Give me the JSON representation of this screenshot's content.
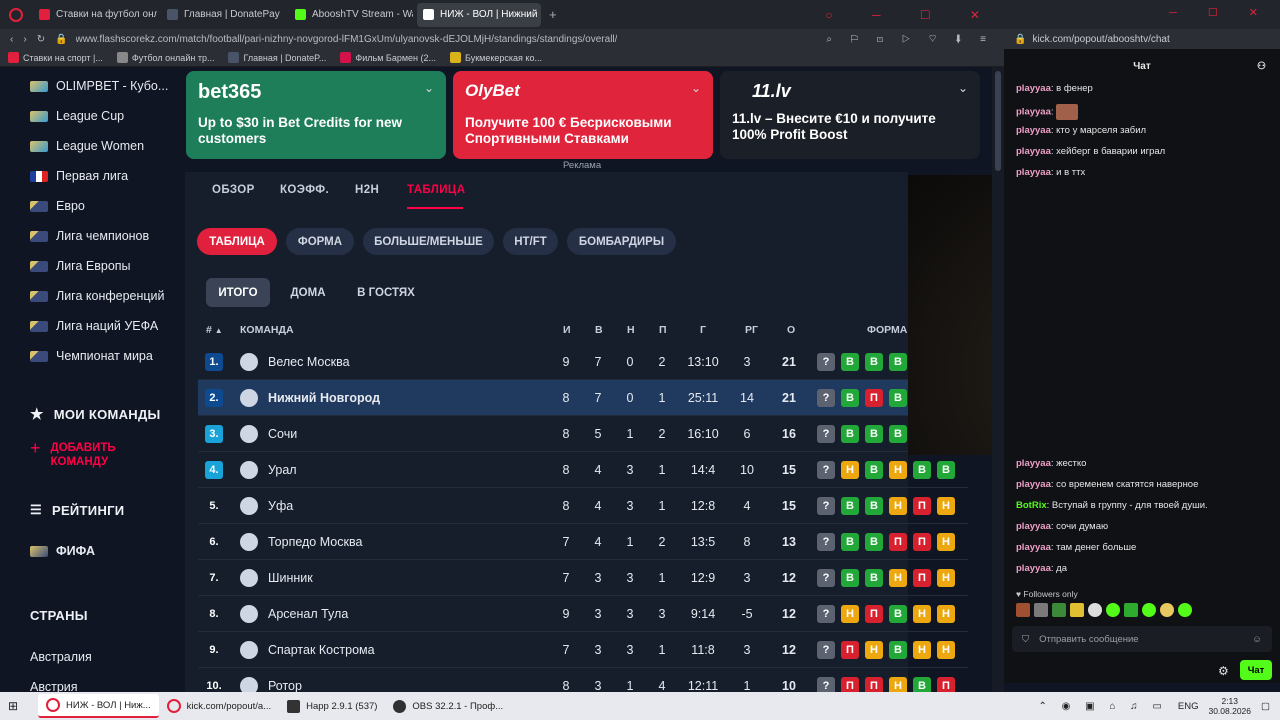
{
  "browser": {
    "tabs": [
      {
        "label": "Ставки на футбол онлайн",
        "color": "#e0203c"
      },
      {
        "label": "Главная | DonatePay",
        "color": "#2a3140"
      },
      {
        "label": "AbooshTV Stream - Watch",
        "color": "#53fc18"
      },
      {
        "label": "НИЖ - ВОЛ | Нижний Нов",
        "color": "#ffffff"
      }
    ],
    "url": "www.flashscorekz.com/match/football/pari-nizhny-novgorod-lFM1GxUm/ulyanovsk-dEJOLMjH/standings/standings/overall/",
    "bookmarks": [
      "Ставки на спорт |...",
      "Футбол онлайн тр...",
      "Главная | DonateP...",
      "Фильм Бармен (2...",
      "Букмекерская ко..."
    ]
  },
  "sidebar": {
    "leagues": [
      "OLIMPBET - Кубо...",
      "League Cup",
      "League Women",
      "Первая лига",
      "Евро",
      "Лига чемпионов",
      "Лига Европы",
      "Лига конференций",
      "Лига наций УЕФА",
      "Чемпионат мира"
    ],
    "my_teams": "МОИ КОМАНДЫ",
    "add_team": "ДОБАВИТЬ КОМАНДУ",
    "ratings": "РЕЙТИНГИ",
    "fifa": "ФИФА",
    "countries_title": "СТРАНЫ",
    "countries": [
      "Австралия",
      "Австрия"
    ]
  },
  "ads": [
    {
      "logo": "bet365",
      "text": "Up to $30 in Bet Credits for new customers",
      "color": "#1e7e5a"
    },
    {
      "logo": "OlyBet",
      "text": "Получите 100 € Бесрисковыми Спортивными Ставками",
      "color": "#e0243c"
    },
    {
      "logo": "11.lv",
      "text": "11.lv – Внесите €10 и получите 100% Profit Boost",
      "color": "#1b1f27"
    }
  ],
  "ad_label": "Реклама",
  "match_tabs": [
    "ОБЗОР",
    "КОЭФФ.",
    "H2H",
    "ТАБЛИЦА"
  ],
  "table_tabs": [
    "ТАБЛИЦА",
    "ФОРМА",
    "БОЛЬШЕ/МЕНЬШЕ",
    "HT/FT",
    "БОМБАРДИРЫ"
  ],
  "venue_tabs": [
    "ИТОГО",
    "ДОМА",
    "В ГОСТЯХ"
  ],
  "headers": {
    "rank": "#",
    "team": "КОМАНДА",
    "played": "И",
    "won": "В",
    "draw": "Н",
    "lost": "П",
    "goals": "Г",
    "gd": "РГ",
    "points": "О",
    "form": "ФОРМА"
  },
  "standings": [
    {
      "rank": "1.",
      "team": "Велес Москва",
      "p": "9",
      "w": "7",
      "d": "0",
      "l": "2",
      "g": "13:10",
      "gd": "3",
      "pts": "21",
      "form": [
        "?",
        "В",
        "В",
        "В"
      ]
    },
    {
      "rank": "2.",
      "team": "Нижний Новгород",
      "p": "8",
      "w": "7",
      "d": "0",
      "l": "1",
      "g": "25:11",
      "gd": "14",
      "pts": "21",
      "form": [
        "?",
        "В",
        "П",
        "В"
      ]
    },
    {
      "rank": "3.",
      "team": "Сочи",
      "p": "8",
      "w": "5",
      "d": "1",
      "l": "2",
      "g": "16:10",
      "gd": "6",
      "pts": "16",
      "form": [
        "?",
        "В",
        "В",
        "В"
      ]
    },
    {
      "rank": "4.",
      "team": "Урал",
      "p": "8",
      "w": "4",
      "d": "3",
      "l": "1",
      "g": "14:4",
      "gd": "10",
      "pts": "15",
      "form": [
        "?",
        "Н",
        "В",
        "Н",
        "В",
        "В"
      ]
    },
    {
      "rank": "5.",
      "team": "Уфа",
      "p": "8",
      "w": "4",
      "d": "3",
      "l": "1",
      "g": "12:8",
      "gd": "4",
      "pts": "15",
      "form": [
        "?",
        "В",
        "В",
        "Н",
        "П",
        "Н"
      ]
    },
    {
      "rank": "6.",
      "team": "Торпедо Москва",
      "p": "7",
      "w": "4",
      "d": "1",
      "l": "2",
      "g": "13:5",
      "gd": "8",
      "pts": "13",
      "form": [
        "?",
        "В",
        "В",
        "П",
        "П",
        "Н"
      ]
    },
    {
      "rank": "7.",
      "team": "Шинник",
      "p": "7",
      "w": "3",
      "d": "3",
      "l": "1",
      "g": "12:9",
      "gd": "3",
      "pts": "12",
      "form": [
        "?",
        "В",
        "В",
        "Н",
        "П",
        "Н"
      ]
    },
    {
      "rank": "8.",
      "team": "Арсенал Тула",
      "p": "9",
      "w": "3",
      "d": "3",
      "l": "3",
      "g": "9:14",
      "gd": "-5",
      "pts": "12",
      "form": [
        "?",
        "Н",
        "П",
        "В",
        "Н",
        "Н"
      ]
    },
    {
      "rank": "9.",
      "team": "Спартак Кострома",
      "p": "7",
      "w": "3",
      "d": "3",
      "l": "1",
      "g": "11:8",
      "gd": "3",
      "pts": "12",
      "form": [
        "?",
        "П",
        "Н",
        "В",
        "Н",
        "Н"
      ]
    },
    {
      "rank": "10.",
      "team": "Ротор",
      "p": "8",
      "w": "3",
      "d": "1",
      "l": "4",
      "g": "12:11",
      "gd": "1",
      "pts": "10",
      "form": [
        "?",
        "П",
        "П",
        "Н",
        "В",
        "П"
      ]
    }
  ],
  "chat": {
    "url": "kick.com/popout/abooshtv/chat",
    "title": "Чат",
    "messages_top": [
      {
        "user": "playyaa",
        "text": "в фенер"
      },
      {
        "user": "playyaa",
        "text": ""
      },
      {
        "user": "playyaa",
        "text": "кто у марселя забил"
      },
      {
        "user": "playyaa",
        "text": "хейберг в баварии играл"
      },
      {
        "user": "playyaa",
        "text": "и в ттх"
      }
    ],
    "messages_bottom": [
      {
        "user": "playyaa",
        "text": "жестко"
      },
      {
        "user": "playyaa",
        "text": "со временем скатятся наверное"
      },
      {
        "user": "BotRix",
        "text": "Вступай в группу - для твоей души."
      },
      {
        "user": "playyaa",
        "text": "сочи думаю"
      },
      {
        "user": "playyaa",
        "text": "там денег больше"
      },
      {
        "user": "playyaa",
        "text": "да"
      }
    ],
    "followers_only": "Followers only",
    "input_placeholder": "Отправить сообщение",
    "send_label": "Чат"
  },
  "taskbar": {
    "items": [
      "НИЖ - ВОЛ | Ниж...",
      "kick.com/popout/a...",
      "Happ 2.9.1 (537)",
      "OBS 32.2.1 - Проф..."
    ],
    "lang": "ENG",
    "time": "2:13",
    "date": "30.08.2026"
  },
  "colors": {
    "win": "#22a838",
    "loss": "#d8212f",
    "draw": "#eda70f",
    "unknown": "#5c6270",
    "accent": "#ff0046",
    "rank_top": "#0d4a8f",
    "rank_cyan": "#1aa3d8"
  }
}
